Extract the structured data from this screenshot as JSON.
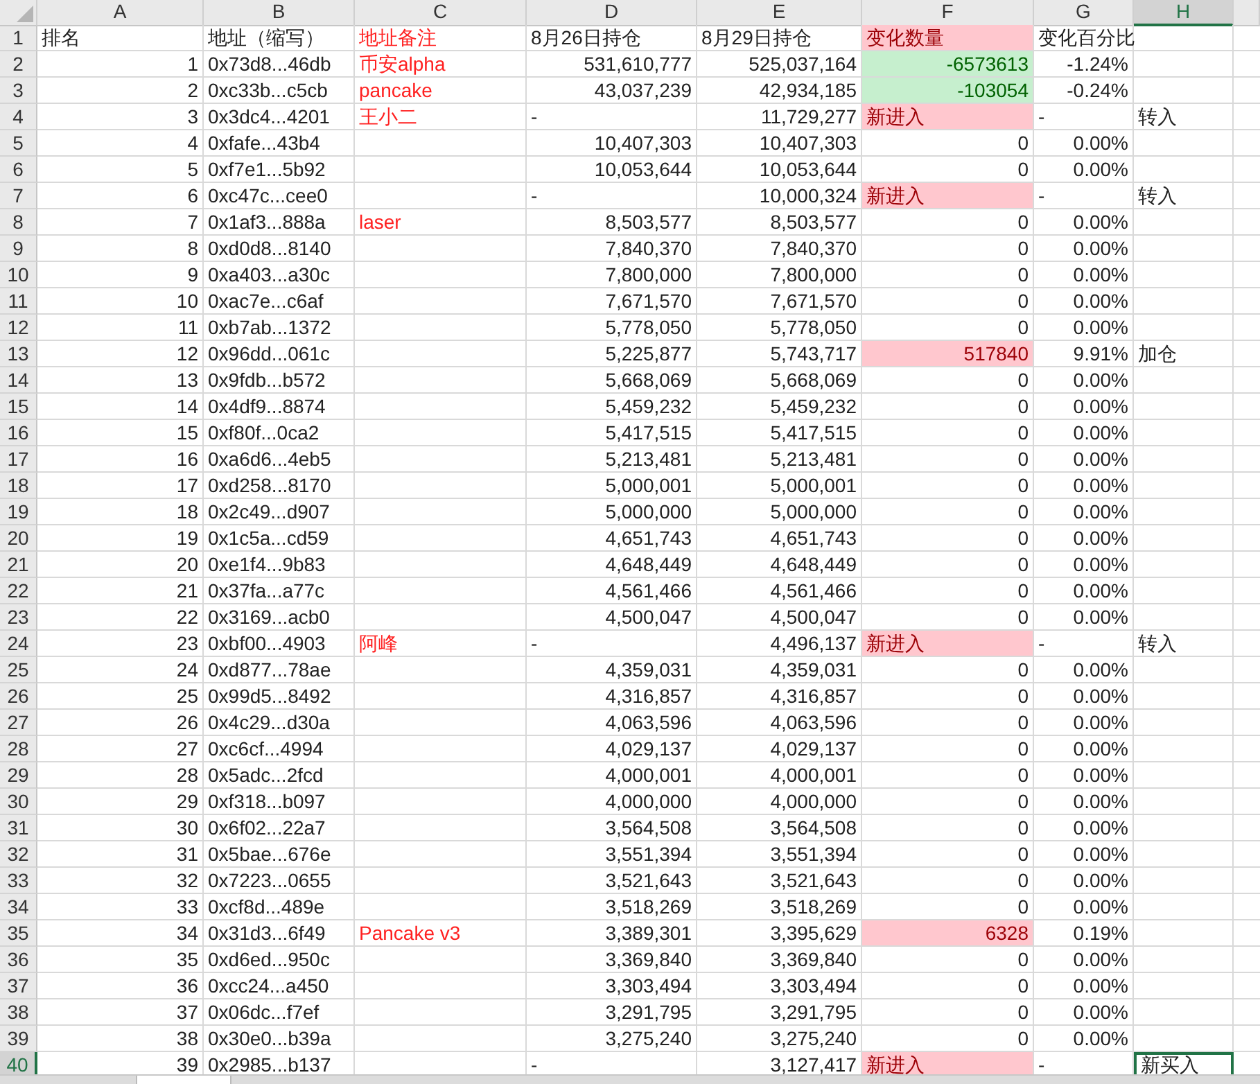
{
  "columns": [
    {
      "label": "A",
      "selected": false
    },
    {
      "label": "B",
      "selected": false
    },
    {
      "label": "C",
      "selected": false
    },
    {
      "label": "D",
      "selected": false
    },
    {
      "label": "E",
      "selected": false
    },
    {
      "label": "F",
      "selected": false
    },
    {
      "label": "G",
      "selected": false
    },
    {
      "label": "H",
      "selected": true
    }
  ],
  "header_row": {
    "n": "1",
    "rank": "排名",
    "address": "地址（缩写）",
    "note": "地址备注",
    "aug26": "8月26日持仓",
    "aug29": "8月29日持仓",
    "change": "变化数量",
    "pct": "变化百分比"
  },
  "rows": [
    {
      "n": "2",
      "rank": "1",
      "address": "0x73d8...46db",
      "note": "币安alpha",
      "aug26": "531,610,777",
      "aug29": "525,037,164",
      "change": "-6573613",
      "kind": "decrease",
      "pct": "-1.24%",
      "selected": false
    },
    {
      "n": "3",
      "rank": "2",
      "address": "0xc33b...c5cb",
      "note": "pancake",
      "aug26": "43,037,239",
      "aug29": "42,934,185",
      "change": "-103054",
      "kind": "decrease",
      "pct": "-0.24%",
      "selected": false
    },
    {
      "n": "4",
      "rank": "3",
      "address": "0x3dc4...4201",
      "note": "王小二",
      "aug26": "-",
      "aug29": "11,729,277",
      "change": "新进入",
      "kind": "new",
      "pct": "-",
      "remark": "转入",
      "selected": false
    },
    {
      "n": "5",
      "rank": "4",
      "address": "0xfafe...43b4",
      "aug26": "10,407,303",
      "aug29": "10,407,303",
      "change": "0",
      "kind": "same",
      "pct": "0.00%",
      "selected": false
    },
    {
      "n": "6",
      "rank": "5",
      "address": "0xf7e1...5b92",
      "aug26": "10,053,644",
      "aug29": "10,053,644",
      "change": "0",
      "kind": "same",
      "pct": "0.00%",
      "selected": false
    },
    {
      "n": "7",
      "rank": "6",
      "address": "0xc47c...cee0",
      "aug26": "-",
      "aug29": "10,000,324",
      "change": "新进入",
      "kind": "new",
      "pct": "-",
      "remark": "转入",
      "selected": false
    },
    {
      "n": "8",
      "rank": "7",
      "address": "0x1af3...888a",
      "note": "laser",
      "aug26": "8,503,577",
      "aug29": "8,503,577",
      "change": "0",
      "kind": "same",
      "pct": "0.00%",
      "selected": false
    },
    {
      "n": "9",
      "rank": "8",
      "address": "0xd0d8...8140",
      "aug26": "7,840,370",
      "aug29": "7,840,370",
      "change": "0",
      "kind": "same",
      "pct": "0.00%",
      "selected": false
    },
    {
      "n": "10",
      "rank": "9",
      "address": "0xa403...a30c",
      "aug26": "7,800,000",
      "aug29": "7,800,000",
      "change": "0",
      "kind": "same",
      "pct": "0.00%",
      "selected": false
    },
    {
      "n": "11",
      "rank": "10",
      "address": "0xac7e...c6af",
      "aug26": "7,671,570",
      "aug29": "7,671,570",
      "change": "0",
      "kind": "same",
      "pct": "0.00%",
      "selected": false
    },
    {
      "n": "12",
      "rank": "11",
      "address": "0xb7ab...1372",
      "aug26": "5,778,050",
      "aug29": "5,778,050",
      "change": "0",
      "kind": "same",
      "pct": "0.00%",
      "selected": false
    },
    {
      "n": "13",
      "rank": "12",
      "address": "0x96dd...061c",
      "aug26": "5,225,877",
      "aug29": "5,743,717",
      "change": "517840",
      "kind": "increase",
      "pct": "9.91%",
      "remark": "加仓",
      "selected": false
    },
    {
      "n": "14",
      "rank": "13",
      "address": "0x9fdb...b572",
      "aug26": "5,668,069",
      "aug29": "5,668,069",
      "change": "0",
      "kind": "same",
      "pct": "0.00%",
      "selected": false
    },
    {
      "n": "15",
      "rank": "14",
      "address": "0x4df9...8874",
      "aug26": "5,459,232",
      "aug29": "5,459,232",
      "change": "0",
      "kind": "same",
      "pct": "0.00%",
      "selected": false
    },
    {
      "n": "16",
      "rank": "15",
      "address": "0xf80f...0ca2",
      "aug26": "5,417,515",
      "aug29": "5,417,515",
      "change": "0",
      "kind": "same",
      "pct": "0.00%",
      "selected": false
    },
    {
      "n": "17",
      "rank": "16",
      "address": "0xa6d6...4eb5",
      "aug26": "5,213,481",
      "aug29": "5,213,481",
      "change": "0",
      "kind": "same",
      "pct": "0.00%",
      "selected": false
    },
    {
      "n": "18",
      "rank": "17",
      "address": "0xd258...8170",
      "aug26": "5,000,001",
      "aug29": "5,000,001",
      "change": "0",
      "kind": "same",
      "pct": "0.00%",
      "selected": false
    },
    {
      "n": "19",
      "rank": "18",
      "address": "0x2c49...d907",
      "aug26": "5,000,000",
      "aug29": "5,000,000",
      "change": "0",
      "kind": "same",
      "pct": "0.00%",
      "selected": false
    },
    {
      "n": "20",
      "rank": "19",
      "address": "0x1c5a...cd59",
      "aug26": "4,651,743",
      "aug29": "4,651,743",
      "change": "0",
      "kind": "same",
      "pct": "0.00%",
      "selected": false
    },
    {
      "n": "21",
      "rank": "20",
      "address": "0xe1f4...9b83",
      "aug26": "4,648,449",
      "aug29": "4,648,449",
      "change": "0",
      "kind": "same",
      "pct": "0.00%",
      "selected": false
    },
    {
      "n": "22",
      "rank": "21",
      "address": "0x37fa...a77c",
      "aug26": "4,561,466",
      "aug29": "4,561,466",
      "change": "0",
      "kind": "same",
      "pct": "0.00%",
      "selected": false
    },
    {
      "n": "23",
      "rank": "22",
      "address": "0x3169...acb0",
      "aug26": "4,500,047",
      "aug29": "4,500,047",
      "change": "0",
      "kind": "same",
      "pct": "0.00%",
      "selected": false
    },
    {
      "n": "24",
      "rank": "23",
      "address": "0xbf00...4903",
      "note": "阿峰",
      "aug26": "-",
      "aug29": "4,496,137",
      "change": "新进入",
      "kind": "new",
      "pct": "-",
      "remark": "转入",
      "selected": false
    },
    {
      "n": "25",
      "rank": "24",
      "address": "0xd877...78ae",
      "aug26": "4,359,031",
      "aug29": "4,359,031",
      "change": "0",
      "kind": "same",
      "pct": "0.00%",
      "selected": false
    },
    {
      "n": "26",
      "rank": "25",
      "address": "0x99d5...8492",
      "aug26": "4,316,857",
      "aug29": "4,316,857",
      "change": "0",
      "kind": "same",
      "pct": "0.00%",
      "selected": false
    },
    {
      "n": "27",
      "rank": "26",
      "address": "0x4c29...d30a",
      "aug26": "4,063,596",
      "aug29": "4,063,596",
      "change": "0",
      "kind": "same",
      "pct": "0.00%",
      "selected": false
    },
    {
      "n": "28",
      "rank": "27",
      "address": "0xc6cf...4994",
      "aug26": "4,029,137",
      "aug29": "4,029,137",
      "change": "0",
      "kind": "same",
      "pct": "0.00%",
      "selected": false
    },
    {
      "n": "29",
      "rank": "28",
      "address": "0x5adc...2fcd",
      "aug26": "4,000,001",
      "aug29": "4,000,001",
      "change": "0",
      "kind": "same",
      "pct": "0.00%",
      "selected": false
    },
    {
      "n": "30",
      "rank": "29",
      "address": "0xf318...b097",
      "aug26": "4,000,000",
      "aug29": "4,000,000",
      "change": "0",
      "kind": "same",
      "pct": "0.00%",
      "selected": false
    },
    {
      "n": "31",
      "rank": "30",
      "address": "0x6f02...22a7",
      "aug26": "3,564,508",
      "aug29": "3,564,508",
      "change": "0",
      "kind": "same",
      "pct": "0.00%",
      "selected": false
    },
    {
      "n": "32",
      "rank": "31",
      "address": "0x5bae...676e",
      "aug26": "3,551,394",
      "aug29": "3,551,394",
      "change": "0",
      "kind": "same",
      "pct": "0.00%",
      "selected": false
    },
    {
      "n": "33",
      "rank": "32",
      "address": "0x7223...0655",
      "aug26": "3,521,643",
      "aug29": "3,521,643",
      "change": "0",
      "kind": "same",
      "pct": "0.00%",
      "selected": false
    },
    {
      "n": "34",
      "rank": "33",
      "address": "0xcf8d...489e",
      "aug26": "3,518,269",
      "aug29": "3,518,269",
      "change": "0",
      "kind": "same",
      "pct": "0.00%",
      "selected": false
    },
    {
      "n": "35",
      "rank": "34",
      "address": "0x31d3...6f49",
      "note": "Pancake v3",
      "aug26": "3,389,301",
      "aug29": "3,395,629",
      "change": "6328",
      "kind": "increase",
      "pct": "0.19%",
      "selected": false
    },
    {
      "n": "36",
      "rank": "35",
      "address": "0xd6ed...950c",
      "aug26": "3,369,840",
      "aug29": "3,369,840",
      "change": "0",
      "kind": "same",
      "pct": "0.00%",
      "selected": false
    },
    {
      "n": "37",
      "rank": "36",
      "address": "0xcc24...a450",
      "aug26": "3,303,494",
      "aug29": "3,303,494",
      "change": "0",
      "kind": "same",
      "pct": "0.00%",
      "selected": false
    },
    {
      "n": "38",
      "rank": "37",
      "address": "0x06dc...f7ef",
      "aug26": "3,291,795",
      "aug29": "3,291,795",
      "change": "0",
      "kind": "same",
      "pct": "0.00%",
      "selected": false
    },
    {
      "n": "39",
      "rank": "38",
      "address": "0x30e0...b39a",
      "aug26": "3,275,240",
      "aug29": "3,275,240",
      "change": "0",
      "kind": "same",
      "pct": "0.00%",
      "selected": false
    },
    {
      "n": "40",
      "rank": "39",
      "address": "0x2985...b137",
      "aug26": "-",
      "aug29": "3,127,417",
      "change": "新进入",
      "kind": "new",
      "pct": "-",
      "remark": "新买入",
      "selected": true
    }
  ]
}
